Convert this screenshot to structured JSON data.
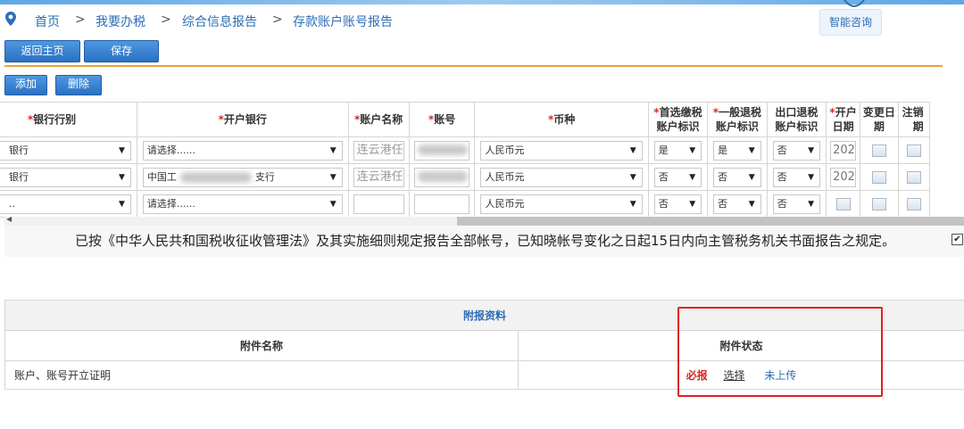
{
  "breadcrumb": {
    "items": [
      "首页",
      "我要办税",
      "综合信息报告",
      "存款账户账号报告"
    ],
    "separator": ">"
  },
  "consult_label": "智能咨询",
  "toolbar": {
    "back_label": "返回主页",
    "save_label": "保存"
  },
  "table_toolbar": {
    "add_label": "添加",
    "delete_label": "删除"
  },
  "grid": {
    "required_mark": "*",
    "headers": {
      "bank_type": "银行行别",
      "open_bank": "开户银行",
      "account_name": "账户名称",
      "account_no": "账号",
      "currency": "币种",
      "tax_pay_1": "首选缴税",
      "tax_pay_2": "账户标识",
      "refund_1": "一般退税",
      "refund_2": "账户标识",
      "export_1": "出口退税",
      "export_2": "账户标识",
      "open_date_1": "开户",
      "open_date_2": "日期",
      "change_date_1": "变更日",
      "change_date_2": "期",
      "cancel_1": "注销",
      "cancel_2": "期"
    },
    "rows": [
      {
        "bank_type": "银行",
        "open_bank": "请选择......",
        "account_name": "连云港任",
        "currency": "人民币元",
        "tax_pay": "是",
        "refund": "是",
        "export": "否",
        "open_date": "202"
      },
      {
        "bank_type": "银行",
        "open_bank_prefix": "中国工",
        "open_bank_suffix": "支行",
        "account_name": "连云港任",
        "currency": "人民币元",
        "tax_pay": "否",
        "refund": "否",
        "export": "否",
        "open_date": "202"
      },
      {
        "bank_type": "..",
        "open_bank": "请选择......",
        "account_name": "",
        "currency": "人民币元",
        "tax_pay": "否",
        "refund": "否",
        "export": "否",
        "open_date": ""
      }
    ]
  },
  "statement": "已按《中华人民共和国税收征收管理法》及其实施细则规定报告全部帐号，已知晓帐号变化之日起15日内向主管税务机关书面报告之规定。",
  "statement_checked": "✔",
  "attachments": {
    "title": "附报资料",
    "col_name": "附件名称",
    "col_status": "附件状态",
    "rows": [
      {
        "name": "账户、账号开立证明",
        "required": "必报",
        "select": "选择",
        "status": "未上传"
      }
    ]
  },
  "colors": {
    "accent": "#2d6db5",
    "required": "#d42a2a",
    "orange_rule": "#e8a33a",
    "highlight_box": "#e02020"
  }
}
